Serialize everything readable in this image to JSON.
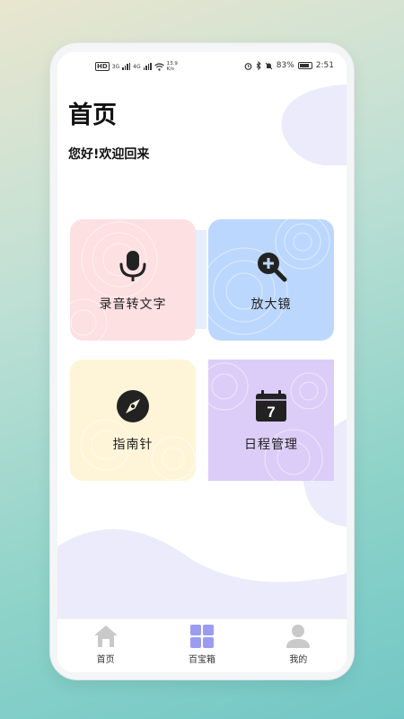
{
  "status_bar": {
    "left_text": "HD",
    "net_1": "3G",
    "net_2": "4G",
    "speed_top": "13.9",
    "speed_bottom": "K/s",
    "battery_percent": "83%",
    "time": "2:51"
  },
  "header": {
    "title": "首页",
    "greeting": "您好!欢迎回来"
  },
  "features": [
    {
      "label": "录音转文字",
      "icon": "microphone-icon",
      "bg": "#fde0e2"
    },
    {
      "label": "放大镜",
      "icon": "magnifier-plus-icon",
      "bg": "#bcd7fe"
    },
    {
      "label": "指南针",
      "icon": "compass-icon",
      "bg": "#fef5d8"
    },
    {
      "label": "日程管理",
      "icon": "calendar-icon",
      "bg": "#dccdf8",
      "calendar_day": "7"
    }
  ],
  "tabbar": {
    "tabs": [
      {
        "label": "首页",
        "icon": "home-icon",
        "active": false
      },
      {
        "label": "百宝箱",
        "icon": "grid-icon",
        "active": true
      },
      {
        "label": "我的",
        "icon": "user-icon",
        "active": false
      }
    ]
  },
  "colors": {
    "accent": "#9b9cf0",
    "blob": "#ecebfb",
    "inactive_icon": "#c9c9c9"
  }
}
